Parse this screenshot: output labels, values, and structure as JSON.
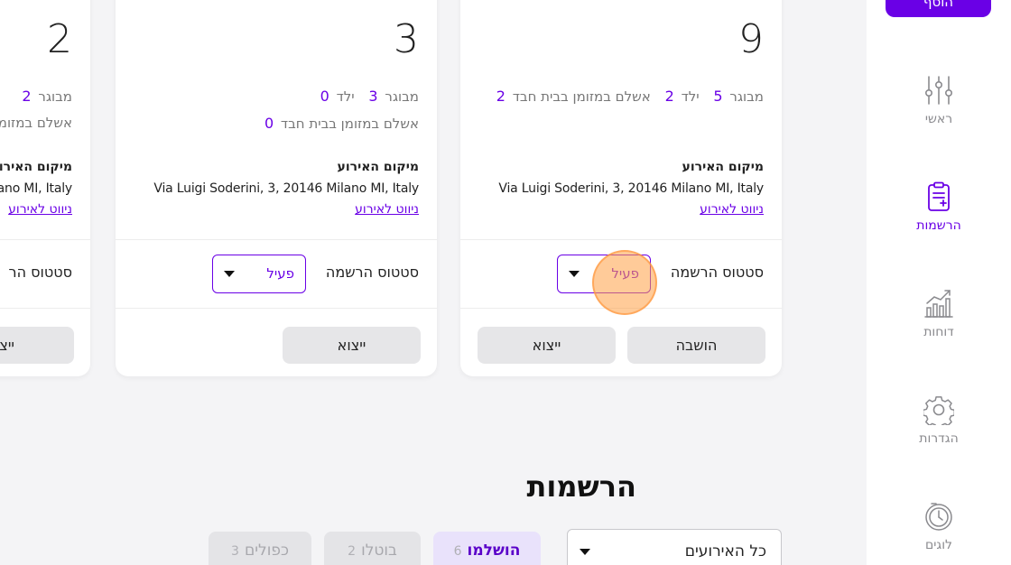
{
  "sidebar": {
    "top_button": "הוסף",
    "items": [
      {
        "label": "ראשי",
        "icon": "sliders-icon"
      },
      {
        "label": "הרשמות",
        "icon": "clipboard-icon"
      },
      {
        "label": "דוחות",
        "icon": "chart-icon"
      },
      {
        "label": "הגדרות",
        "icon": "gear-icon"
      },
      {
        "label": "לוגים",
        "icon": "timer-icon"
      }
    ]
  },
  "cards": [
    {
      "count": "9",
      "adult_label": "מבוגר",
      "adult": "5",
      "child_label": "ילד",
      "child": "2",
      "paid_label": "אשלם במזומן בבית חבד",
      "paid": "2",
      "location_title": "מיקום האירוע",
      "address": "Via Luigi Soderini, 3, 20146 Milano MI, Italy",
      "nav_link": "ניווט לאירוע",
      "status_label": "סטטוס הרשמה",
      "status_value": "פעיל",
      "btn_return": "הושבה",
      "btn_exit": "ייצוא"
    },
    {
      "count": "3",
      "adult_label": "מבוגר",
      "adult": "3",
      "child_label": "ילד",
      "child": "0",
      "paid_label": "אשלם במזומן בבית חבד",
      "paid": "0",
      "location_title": "מיקום האירוע",
      "address": "Via Luigi Soderini, 3, 20146 Milano MI, Italy",
      "nav_link": "ניווט לאירוע",
      "status_label": "סטטוס הרשמה",
      "status_value": "פעיל",
      "btn_exit": "ייצוא"
    },
    {
      "count": "2",
      "adult_label": "מבוגר",
      "adult": "2",
      "paid_label": "אשלם במזומן",
      "location_title": "מיקום האירוע",
      "address": "ano MI, Italy",
      "nav_link": "ניווט לאירוע",
      "status_label": "סטטוס הר",
      "btn_exit": "ייצו"
    }
  ],
  "registrations": {
    "title": "הרשמות",
    "event_select": "כל האירועים",
    "tabs": [
      {
        "label": "הושלמו",
        "count": "6"
      },
      {
        "label": "בוטלו",
        "count": "2"
      },
      {
        "label": "כפולים",
        "count": "3"
      }
    ]
  },
  "colors": {
    "accent": "#6a00e6",
    "background": "#f4f4f6",
    "muted": "#8a8a8e"
  }
}
